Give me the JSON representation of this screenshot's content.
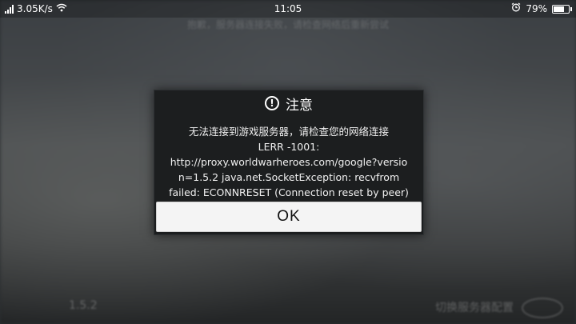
{
  "status_bar": {
    "network_speed": "3.05K/s",
    "time": "11:05",
    "battery_percent": "79%",
    "battery_level": 0.79
  },
  "background": {
    "top_text": "抱歉，服务器连接失败，请检查网络后重新尝试",
    "version": "1.5.2",
    "server_label": "切换服务器配置"
  },
  "dialog": {
    "title": "注意",
    "message_lines": [
      "无法连接到游戏服务器，请检查您的网络连接",
      "LERR -1001:",
      "http://proxy.worldwarheroes.com/google?versio",
      "n=1.5.2 java.net.SocketException: recvfrom",
      "failed: ECONNRESET (Connection reset by peer)"
    ],
    "ok_label": "OK"
  }
}
